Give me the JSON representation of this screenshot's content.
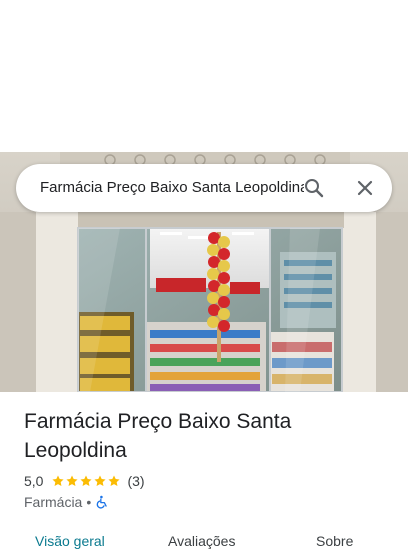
{
  "search": {
    "query": "Farmácia Preço Baixo Santa Leopoldina"
  },
  "place": {
    "name": "Farmácia Preço Baixo Santa Leopoldina",
    "rating": "5,0",
    "star_count": 5,
    "reviews": "(3)",
    "category": "Farmácia",
    "separator": "•"
  },
  "tabs": [
    {
      "label": "Visão geral",
      "active": true
    },
    {
      "label": "Avaliações",
      "active": false
    },
    {
      "label": "Sobre",
      "active": false
    }
  ],
  "colors": {
    "star": "#fbbc04",
    "active_tab": "#0b7a8f",
    "accessibility_icon": "#1a73e8"
  },
  "icons": {
    "search": "search-icon",
    "close": "close-icon",
    "accessibility": "wheelchair-icon"
  }
}
